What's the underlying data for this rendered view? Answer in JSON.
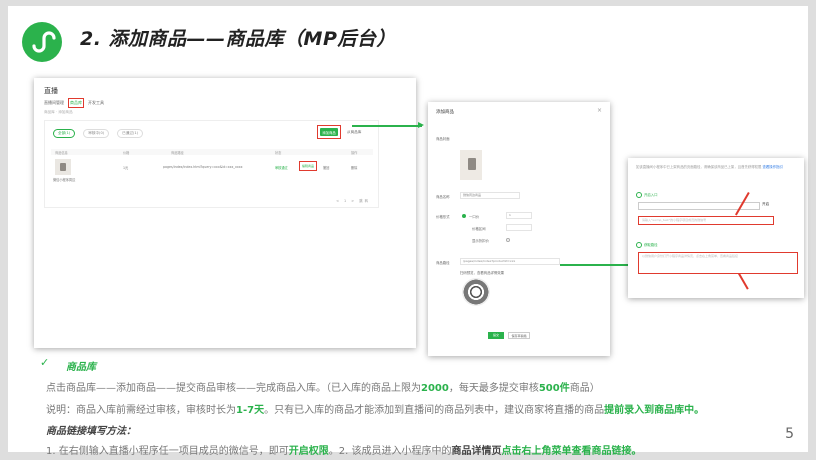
{
  "slide": {
    "title": "2. 添加商品——商品库（MP后台）",
    "page_number": "5"
  },
  "shot_list": {
    "header": "直播",
    "tabs": [
      "直播间管理",
      "商品库",
      "开发工具"
    ],
    "sub": "商品库 · 添加商品",
    "filters": [
      "全部(1)",
      "审核中(0)",
      "已通过(1)"
    ],
    "add_button": "添加商品",
    "add_link": "从商品库",
    "columns": [
      "商品信息",
      "价格",
      "商品路径",
      "状态",
      "操作"
    ],
    "row": {
      "name": "微信小程序周边",
      "price": "1元",
      "path": "pages/index/index.html?query=xxx&id=xxx_xxxx",
      "status": "审核通过",
      "edit": "编辑商品",
      "actions": [
        "撤回",
        "删除"
      ]
    },
    "pager": "< 1 >  跳转"
  },
  "shot_dialog": {
    "title": "添加商品",
    "fields": {
      "cover": "商品封面",
      "name_label": "商品名称",
      "name_value": "微信周边商品",
      "price_label": "价格形式",
      "price_option": "一口价",
      "price_value": "1",
      "range_label": "价格区间",
      "discount_label": "显示折扣价",
      "path_label": "商品路径",
      "path_value": "/pages/index/index?productId=xxx",
      "path_hint": "扫码预览，查看商品详情效果"
    },
    "submit": "提交",
    "save": "保存草稿箱"
  },
  "shot_perm": {
    "intro": "如该直播间小程序中已上架商品的页面路径，请确保该商品已上架，且首先获得权限",
    "intro_link": "查看操作指引",
    "step1": "开启入口",
    "open_label": "开启",
    "box1": "请输入\"wxmp_test\"的小程序项目成员的微信号",
    "step2": "获取路径",
    "box2": "以微信用户身份打开小程序商品详情页，点击右上角菜单，查看商品链接"
  },
  "text": {
    "check": "✓",
    "heading_lib": "商品库",
    "line1_pre": "点击商品库——添加商品——提交商品审核——完成商品入库。（已入库的商品上限为",
    "line1_limit": "2000",
    "line1_mid": "，每天最多提交审核",
    "line1_daily": "500件",
    "line1_post": "商品）",
    "line2_pre": "说明：商品入库前需经过审核，审核时长为",
    "line2_time": "1-7天",
    "line2_mid": "。只有已入库的商品才能添加到直播间的商品列表中，建议商家将直播的商品",
    "line2_emph": "提前录入到商品库中。",
    "heading_fill": "商品链接填写方法：",
    "line3_pre": "1. 在右侧输入直播小程序任一项目成员的微信号，即可",
    "line3_emph": "开启权限",
    "line3_mid": "。2. 该成员进入小程序中的",
    "line3_bold": "商品详情页",
    "line3_post": "点击右上角菜单查看商品链接。"
  },
  "colors": {
    "brand_green": "#2bb24c",
    "highlight_red": "#e03a2e"
  }
}
